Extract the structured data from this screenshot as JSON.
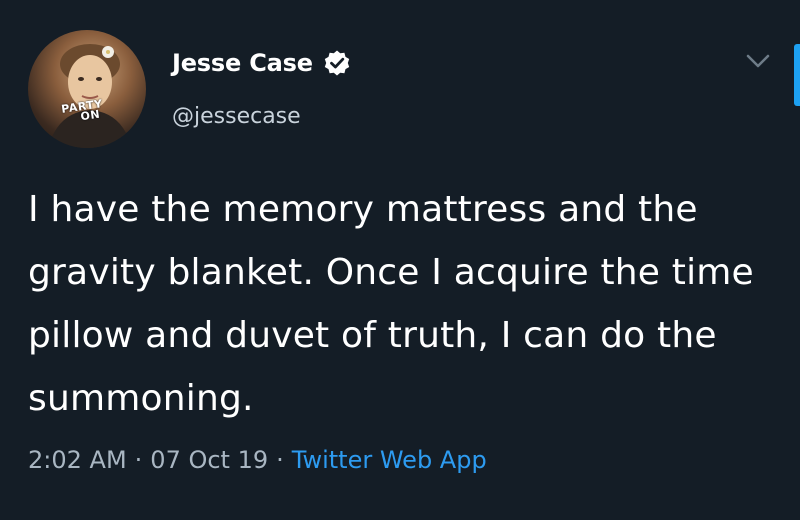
{
  "author": {
    "display_name": "Jesse Case",
    "handle": "@jessecase",
    "verified": true,
    "avatar_badge_line1": "PARTY",
    "avatar_badge_line2": "ON"
  },
  "tweet": {
    "text": "I have the memory mattress and the gravity blanket. Once I acquire the time pillow and duvet of truth, I can do the summoning.",
    "time": "2:02 AM",
    "date": "07 Oct 19",
    "source": "Twitter Web App",
    "separator": "·"
  },
  "icons": {
    "verified": "verified-badge-icon",
    "menu": "chevron-down-icon"
  },
  "colors": {
    "background": "#141d26",
    "link": "#2d9bf0",
    "secondary_text": "#a9b6c2"
  }
}
